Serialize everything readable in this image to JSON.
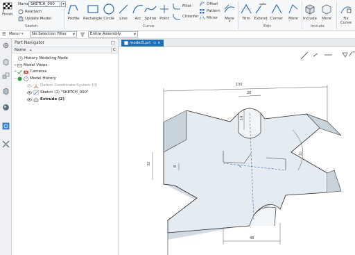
{
  "ribbon": {
    "finish": "Finish",
    "name_label": "Name",
    "name_value": "SKETCH_000",
    "reattach": "Reattach",
    "update_model": "Update Model",
    "sketch_group": "Sketch",
    "profile": "Profile",
    "rectangle": "Rectangle",
    "circle": "Circle",
    "line": "Line",
    "arc": "Arc",
    "spline": "Spline",
    "point": "Point",
    "fillet": "Fillet",
    "chamfer": "Chamfer",
    "offset": "Offset",
    "pattern": "Pattern",
    "mirror": "Mirror",
    "more": "More",
    "curve_group": "Curve",
    "trim": "Trim",
    "extend": "Extend",
    "corner": "Corner",
    "edit_group": "Edit",
    "include": "Include",
    "include_group": "Include",
    "fix_curve": "Fix",
    "fix_curve2": "Curve"
  },
  "toolbar2": {
    "menu": "Menu",
    "selection_filter": "No Selection Filter",
    "assembly_scope": "Entire Assembly"
  },
  "navigator": {
    "title": "Part Navigator",
    "col_name": "Name",
    "col_c": "C",
    "items": [
      {
        "label": "History Modeling Mode"
      },
      {
        "label": "Model Views"
      },
      {
        "label": "Cameras"
      },
      {
        "label": "Model History"
      },
      {
        "label": "Datum Coordinate System (0)"
      },
      {
        "label": "Sketch (1) \"SKETCH_000\""
      },
      {
        "label": "Extrude (2)"
      }
    ]
  },
  "graphics": {
    "tab_label": "model3.prt",
    "dims": {
      "d130": "130",
      "d28": "28",
      "d14": "14",
      "d32": "32",
      "d8": "8",
      "d30": "30",
      "d48": "48"
    }
  },
  "colors": {
    "accent": "#1f6fb5",
    "model_fill": "#dfe7ee",
    "dimension": "#555555",
    "ribbon_icon": "#2b6cb0"
  }
}
